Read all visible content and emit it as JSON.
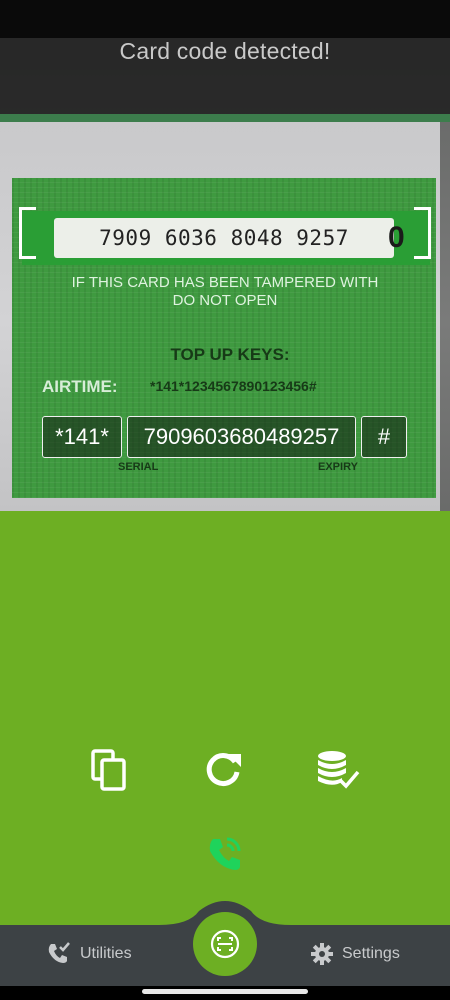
{
  "scanner": {
    "status_text": "Card code detected!",
    "detected_code": "7909 6036 8048 9257",
    "card_warning_line1": "IF THIS CARD HAS BEEN TAMPERED WITH",
    "card_warning_line2": "DO NOT OPEN",
    "card_heading": "TOP UP KEYS:",
    "card_airtime_label": "AIRTIME:",
    "card_airtime_code": "*141*1234567890123456#",
    "card_serial_label": "SERIAL",
    "card_expiry_label": "EXPIRY"
  },
  "ussd": {
    "prefix": "*141*",
    "number": "7909603680489257",
    "suffix": "#"
  },
  "actions": {
    "copy_icon": "copy-icon",
    "refresh_icon": "refresh-icon",
    "save_icon": "database-check-icon",
    "call_icon": "phone-call-icon"
  },
  "nav": {
    "utilities_label": "Utilities",
    "settings_label": "Settings",
    "scan_icon": "scan-icon"
  },
  "colors": {
    "accent": "#6daf23",
    "nav_bg": "#3d4245",
    "call_green": "#1fd35b"
  }
}
